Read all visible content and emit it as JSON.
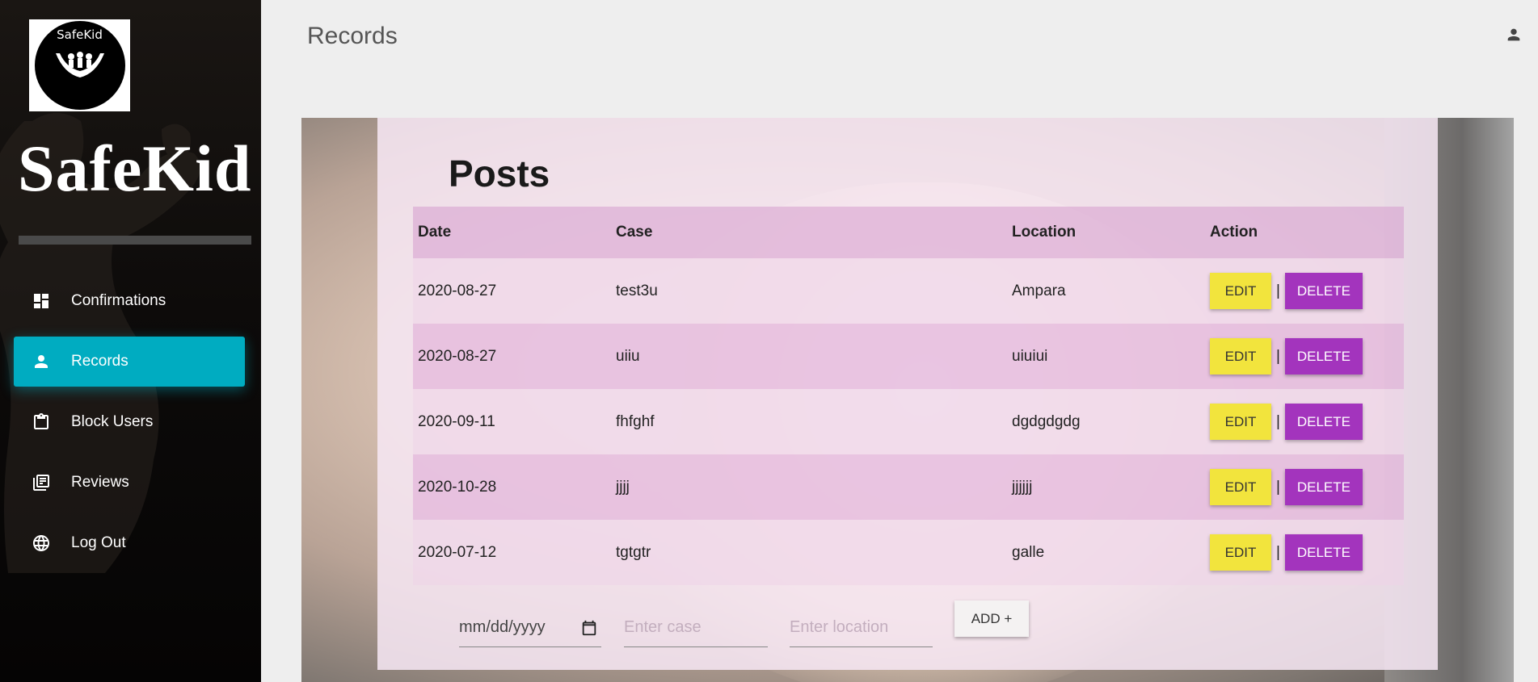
{
  "sidebar": {
    "logo_text": "SafeKid",
    "brand": "SafeKid",
    "items": [
      {
        "label": "Confirmations",
        "icon": "dashboard-icon"
      },
      {
        "label": "Records",
        "icon": "person-icon",
        "active": true
      },
      {
        "label": "Block Users",
        "icon": "clipboard-icon"
      },
      {
        "label": "Reviews",
        "icon": "library-books-icon"
      },
      {
        "label": "Log Out",
        "icon": "globe-icon"
      }
    ],
    "active_color": "#00acc1"
  },
  "header": {
    "title": "Records",
    "user_icon": "person-icon"
  },
  "posts": {
    "title": "Posts",
    "columns": [
      "Date",
      "Case",
      "Location",
      "Action"
    ],
    "rows": [
      {
        "date": "2020-08-27",
        "case": "test3u",
        "location": "Ampara"
      },
      {
        "date": "2020-08-27",
        "case": "uiiu",
        "location": "uiuiui"
      },
      {
        "date": "2020-09-11",
        "case": "fhfghf",
        "location": "dgdgdgdg"
      },
      {
        "date": "2020-10-28",
        "case": "jjjj",
        "location": "jjjjjj"
      },
      {
        "date": "2020-07-12",
        "case": "tgtgtr",
        "location": "galle"
      }
    ],
    "edit_label": "EDIT",
    "separator": "|",
    "delete_label": "DELETE",
    "edit_color": "#f2e43d",
    "delete_color": "#a334bd"
  },
  "form": {
    "date_placeholder": "mm/dd/yyyy",
    "case_placeholder": "Enter case",
    "location_placeholder": "Enter location",
    "add_label": "ADD +"
  }
}
